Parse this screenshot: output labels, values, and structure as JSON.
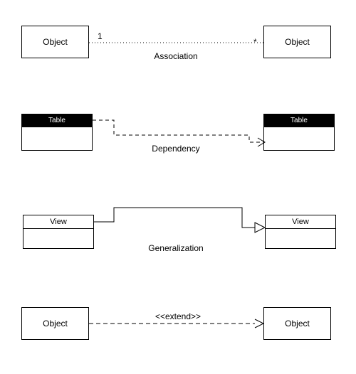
{
  "rows": [
    {
      "left": {
        "label": "Object"
      },
      "right": {
        "label": "Object"
      },
      "caption": "Association",
      "multiplicity_left": "1",
      "multiplicity_right": "*"
    },
    {
      "left": {
        "label": "Table"
      },
      "right": {
        "label": "Table"
      },
      "caption": "Dependency"
    },
    {
      "left": {
        "label": "View"
      },
      "right": {
        "label": "View"
      },
      "caption": "Generalization"
    },
    {
      "left": {
        "label": "Object"
      },
      "right": {
        "label": "Object"
      },
      "stereotype": "<<extend>>"
    }
  ]
}
